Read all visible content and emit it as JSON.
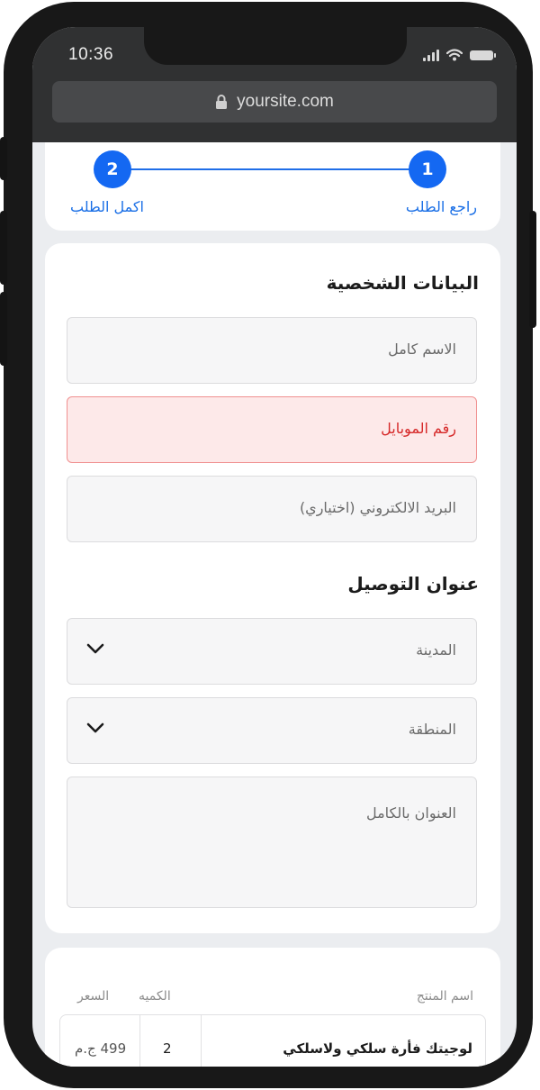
{
  "status_bar": {
    "time": "10:36"
  },
  "browser": {
    "url": "yoursite.com",
    "lock_icon": "lock-icon"
  },
  "stepper": {
    "steps": [
      {
        "number": "1",
        "label": "راجع الطلب"
      },
      {
        "number": "2",
        "label": "اكمل الطلب"
      }
    ],
    "accent_color": "#1468f2"
  },
  "personal": {
    "title": "البيانات الشخصية",
    "full_name_placeholder": "الاسم كامل",
    "mobile_placeholder": "رقم الموبايل",
    "email_placeholder": "البريد الالكتروني (اختياري)"
  },
  "delivery": {
    "title": "عنوان التوصيل",
    "city_placeholder": "المدينة",
    "area_placeholder": "المنطقة",
    "address_placeholder": "العنوان بالكامل"
  },
  "order": {
    "headers": {
      "product": "اسم المنتج",
      "qty": "الكميه",
      "price": "السعر"
    },
    "rows": [
      {
        "product": "لوجيتك فأرة سلكي ولاسلكي",
        "qty": "2",
        "price": "499 ج.م"
      }
    ]
  },
  "colors": {
    "error_bg": "#fde9e9",
    "error_text": "#d62828"
  }
}
